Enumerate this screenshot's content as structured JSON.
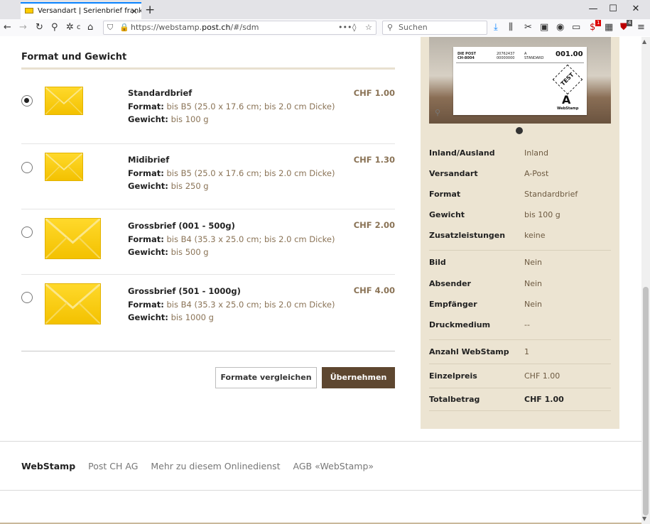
{
  "browser": {
    "tab_title": "Versandart | Serienbrief frankieren",
    "url_prefix": "https://webstamp.",
    "url_domain": "post.ch",
    "url_suffix": "/#/sdm",
    "search_placeholder": "Suchen",
    "badge_1": "1",
    "badge_2": "4"
  },
  "section": {
    "title": "Format und Gewicht"
  },
  "options": [
    {
      "name": "Standardbrief",
      "format_label": "Format:",
      "format_value": "bis B5 (25.0 x 17.6 cm; bis 2.0 cm Dicke)",
      "weight_label": "Gewicht:",
      "weight_value": "bis 100 g",
      "price": "CHF 1.00",
      "selected": true
    },
    {
      "name": "Midibrief",
      "format_label": "Format:",
      "format_value": "bis B5 (25.0 x 17.6 cm; bis 2.0 cm Dicke)",
      "weight_label": "Gewicht:",
      "weight_value": "bis 250 g",
      "price": "CHF 1.30",
      "selected": false
    },
    {
      "name": "Grossbrief (001 - 500g)",
      "format_label": "Format:",
      "format_value": "bis B4 (35.3 x 25.0 cm; bis 2.0 cm Dicke)",
      "weight_label": "Gewicht:",
      "weight_value": "bis 500 g",
      "price": "CHF 2.00",
      "selected": false
    },
    {
      "name": "Grossbrief (501 - 1000g)",
      "format_label": "Format:",
      "format_value": "bis B4 (35.3 x 25.0 cm; bis 2.0 cm Dicke)",
      "weight_label": "Gewicht:",
      "weight_value": "bis 1000 g",
      "price": "CHF 4.00",
      "selected": false
    }
  ],
  "buttons": {
    "compare": "Formate vergleichen",
    "apply": "Übernehmen"
  },
  "stamp_preview": {
    "logo_line1": "DIE POST",
    "logo_line2": "CH-8004",
    "code_line1": "20762437",
    "code_line2": "00000000",
    "class_line1": "A",
    "class_line2": "STANDARD",
    "number": "001.00",
    "test": "TEST",
    "class_letter": "A",
    "brand": "WebStamp"
  },
  "summary": [
    {
      "label": "Inland/Ausland",
      "value": "Inland"
    },
    {
      "label": "Versandart",
      "value": "A-Post"
    },
    {
      "label": "Format",
      "value": "Standardbrief"
    },
    {
      "label": "Gewicht",
      "value": "bis 100 g"
    },
    {
      "label": "Zusatzleistungen",
      "value": "keine"
    },
    {
      "label": "Bild",
      "value": "Nein"
    },
    {
      "label": "Absender",
      "value": "Nein"
    },
    {
      "label": "Empfänger",
      "value": "Nein"
    },
    {
      "label": "Druckmedium",
      "value": "--"
    },
    {
      "label": "Anzahl WebStamp",
      "value": "1"
    },
    {
      "label": "Einzelpreis",
      "value": "CHF 1.00"
    },
    {
      "label": "Totalbetrag",
      "value": "CHF 1.00"
    }
  ],
  "footer": {
    "brand": "WebStamp",
    "company": "Post CH AG",
    "more": "Mehr zu diesem Onlinedienst",
    "agb": "AGB «WebStamp»"
  }
}
